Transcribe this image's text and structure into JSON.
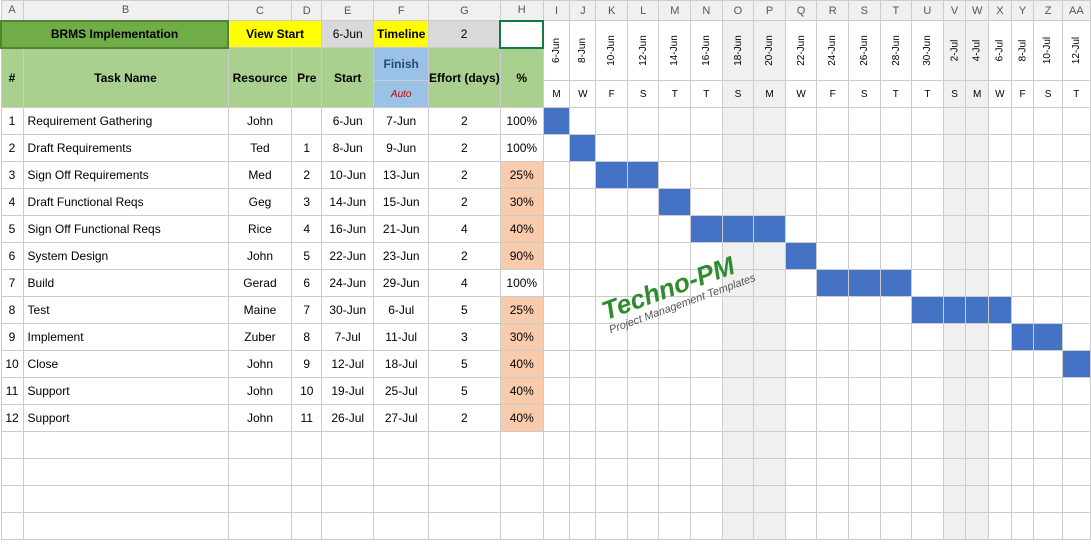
{
  "colLetters": [
    "A",
    "B",
    "C",
    "D",
    "E",
    "F",
    "G",
    "H",
    "I",
    "J",
    "K",
    "L",
    "M",
    "N",
    "O",
    "P",
    "Q",
    "R",
    "S",
    "T",
    "U",
    "V",
    "W",
    "X",
    "Y",
    "Z",
    "AA"
  ],
  "title": "BRMS Implementation",
  "viewStartLabel": "View Start",
  "viewStartDate": "6-Jun",
  "timelineLabel": "Timeline",
  "timelineVal": "2",
  "hdr": {
    "num": "#",
    "task": "Task Name",
    "resource": "Resource",
    "pre": "Pre",
    "start": "Start",
    "finish": "Finish",
    "auto": "Auto",
    "effort": "Effort (days)",
    "pct": "%"
  },
  "dates": [
    "6-Jun",
    "8-Jun",
    "10-Jun",
    "12-Jun",
    "14-Jun",
    "16-Jun",
    "18-Jun",
    "20-Jun",
    "22-Jun",
    "24-Jun",
    "26-Jun",
    "28-Jun",
    "30-Jun",
    "2-Jul",
    "4-Jul",
    "6-Jul",
    "8-Jul",
    "10-Jul",
    "12-Jul"
  ],
  "dow": [
    "M",
    "W",
    "F",
    "S",
    "T",
    "T",
    "S",
    "M",
    "W",
    "F",
    "S",
    "T",
    "T",
    "S",
    "M",
    "W",
    "F",
    "S",
    "T"
  ],
  "shadeCols": [
    6,
    7,
    13,
    14
  ],
  "tasks": [
    {
      "n": "1",
      "name": "Requirement Gathering",
      "res": "John",
      "pre": "",
      "start": "6-Jun",
      "finish": "7-Jun",
      "eff": "2",
      "pct": "100%",
      "peach": false,
      "bars": [
        0
      ]
    },
    {
      "n": "2",
      "name": "Draft  Requirements",
      "res": "Ted",
      "pre": "1",
      "start": "8-Jun",
      "finish": "9-Jun",
      "eff": "2",
      "pct": "100%",
      "peach": false,
      "bars": [
        1
      ]
    },
    {
      "n": "3",
      "name": "Sign Off  Requirements",
      "res": "Med",
      "pre": "2",
      "start": "10-Jun",
      "finish": "13-Jun",
      "eff": "2",
      "pct": "25%",
      "peach": true,
      "bars": [
        2,
        3
      ]
    },
    {
      "n": "4",
      "name": "Draft Functional Reqs",
      "res": "Geg",
      "pre": "3",
      "start": "14-Jun",
      "finish": "15-Jun",
      "eff": "2",
      "pct": "30%",
      "peach": true,
      "bars": [
        4
      ]
    },
    {
      "n": "5",
      "name": "Sign Off Functional Reqs",
      "res": "Rice",
      "pre": "4",
      "start": "16-Jun",
      "finish": "21-Jun",
      "eff": "4",
      "pct": "40%",
      "peach": true,
      "bars": [
        5,
        6,
        7
      ]
    },
    {
      "n": "6",
      "name": "System Design",
      "res": "John",
      "pre": "5",
      "start": "22-Jun",
      "finish": "23-Jun",
      "eff": "2",
      "pct": "90%",
      "peach": true,
      "bars": [
        8
      ]
    },
    {
      "n": "7",
      "name": "Build",
      "res": "Gerad",
      "pre": "6",
      "start": "24-Jun",
      "finish": "29-Jun",
      "eff": "4",
      "pct": "100%",
      "peach": false,
      "bars": [
        9,
        10,
        11
      ]
    },
    {
      "n": "8",
      "name": "Test",
      "res": "Maine",
      "pre": "7",
      "start": "30-Jun",
      "finish": "6-Jul",
      "eff": "5",
      "pct": "25%",
      "peach": true,
      "bars": [
        12,
        13,
        14,
        15
      ]
    },
    {
      "n": "9",
      "name": "Implement",
      "res": "Zuber",
      "pre": "8",
      "start": "7-Jul",
      "finish": "11-Jul",
      "eff": "3",
      "pct": "30%",
      "peach": true,
      "bars": [
        16,
        17
      ]
    },
    {
      "n": "10",
      "name": "Close",
      "res": "John",
      "pre": "9",
      "start": "12-Jul",
      "finish": "18-Jul",
      "eff": "5",
      "pct": "40%",
      "peach": true,
      "bars": [
        18
      ]
    },
    {
      "n": "11",
      "name": "Support",
      "res": "John",
      "pre": "10",
      "start": "19-Jul",
      "finish": "25-Jul",
      "eff": "5",
      "pct": "40%",
      "peach": true,
      "bars": []
    },
    {
      "n": "12",
      "name": "Support",
      "res": "John",
      "pre": "11",
      "start": "26-Jul",
      "finish": "27-Jul",
      "eff": "2",
      "pct": "40%",
      "peach": true,
      "bars": []
    }
  ],
  "watermark": {
    "line1": "Techno-PM",
    "line2": "Project Management Templates"
  },
  "chart_data": {
    "type": "table",
    "title": "BRMS Implementation – Gantt",
    "columns": [
      "#",
      "Task Name",
      "Resource",
      "Pre",
      "Start",
      "Finish",
      "Effort (days)",
      "%"
    ],
    "rows": [
      [
        1,
        "Requirement Gathering",
        "John",
        null,
        "6-Jun",
        "7-Jun",
        2,
        1.0
      ],
      [
        2,
        "Draft Requirements",
        "Ted",
        1,
        "8-Jun",
        "9-Jun",
        2,
        1.0
      ],
      [
        3,
        "Sign Off Requirements",
        "Med",
        2,
        "10-Jun",
        "13-Jun",
        2,
        0.25
      ],
      [
        4,
        "Draft Functional Reqs",
        "Geg",
        3,
        "14-Jun",
        "15-Jun",
        2,
        0.3
      ],
      [
        5,
        "Sign Off Functional Reqs",
        "Rice",
        4,
        "16-Jun",
        "21-Jun",
        4,
        0.4
      ],
      [
        6,
        "System Design",
        "John",
        5,
        "22-Jun",
        "23-Jun",
        2,
        0.9
      ],
      [
        7,
        "Build",
        "Gerad",
        6,
        "24-Jun",
        "29-Jun",
        4,
        1.0
      ],
      [
        8,
        "Test",
        "Maine",
        7,
        "30-Jun",
        "6-Jul",
        5,
        0.25
      ],
      [
        9,
        "Implement",
        "Zuber",
        8,
        "7-Jul",
        "11-Jul",
        3,
        0.3
      ],
      [
        10,
        "Close",
        "John",
        9,
        "12-Jul",
        "18-Jul",
        5,
        0.4
      ],
      [
        11,
        "Support",
        "John",
        10,
        "19-Jul",
        "25-Jul",
        5,
        0.4
      ],
      [
        12,
        "Support",
        "John",
        11,
        "26-Jul",
        "27-Jul",
        2,
        0.4
      ]
    ],
    "timeline": [
      "6-Jun",
      "8-Jun",
      "10-Jun",
      "12-Jun",
      "14-Jun",
      "16-Jun",
      "18-Jun",
      "20-Jun",
      "22-Jun",
      "24-Jun",
      "26-Jun",
      "28-Jun",
      "30-Jun",
      "2-Jul",
      "4-Jul",
      "6-Jul",
      "8-Jul",
      "10-Jul",
      "12-Jul"
    ]
  }
}
